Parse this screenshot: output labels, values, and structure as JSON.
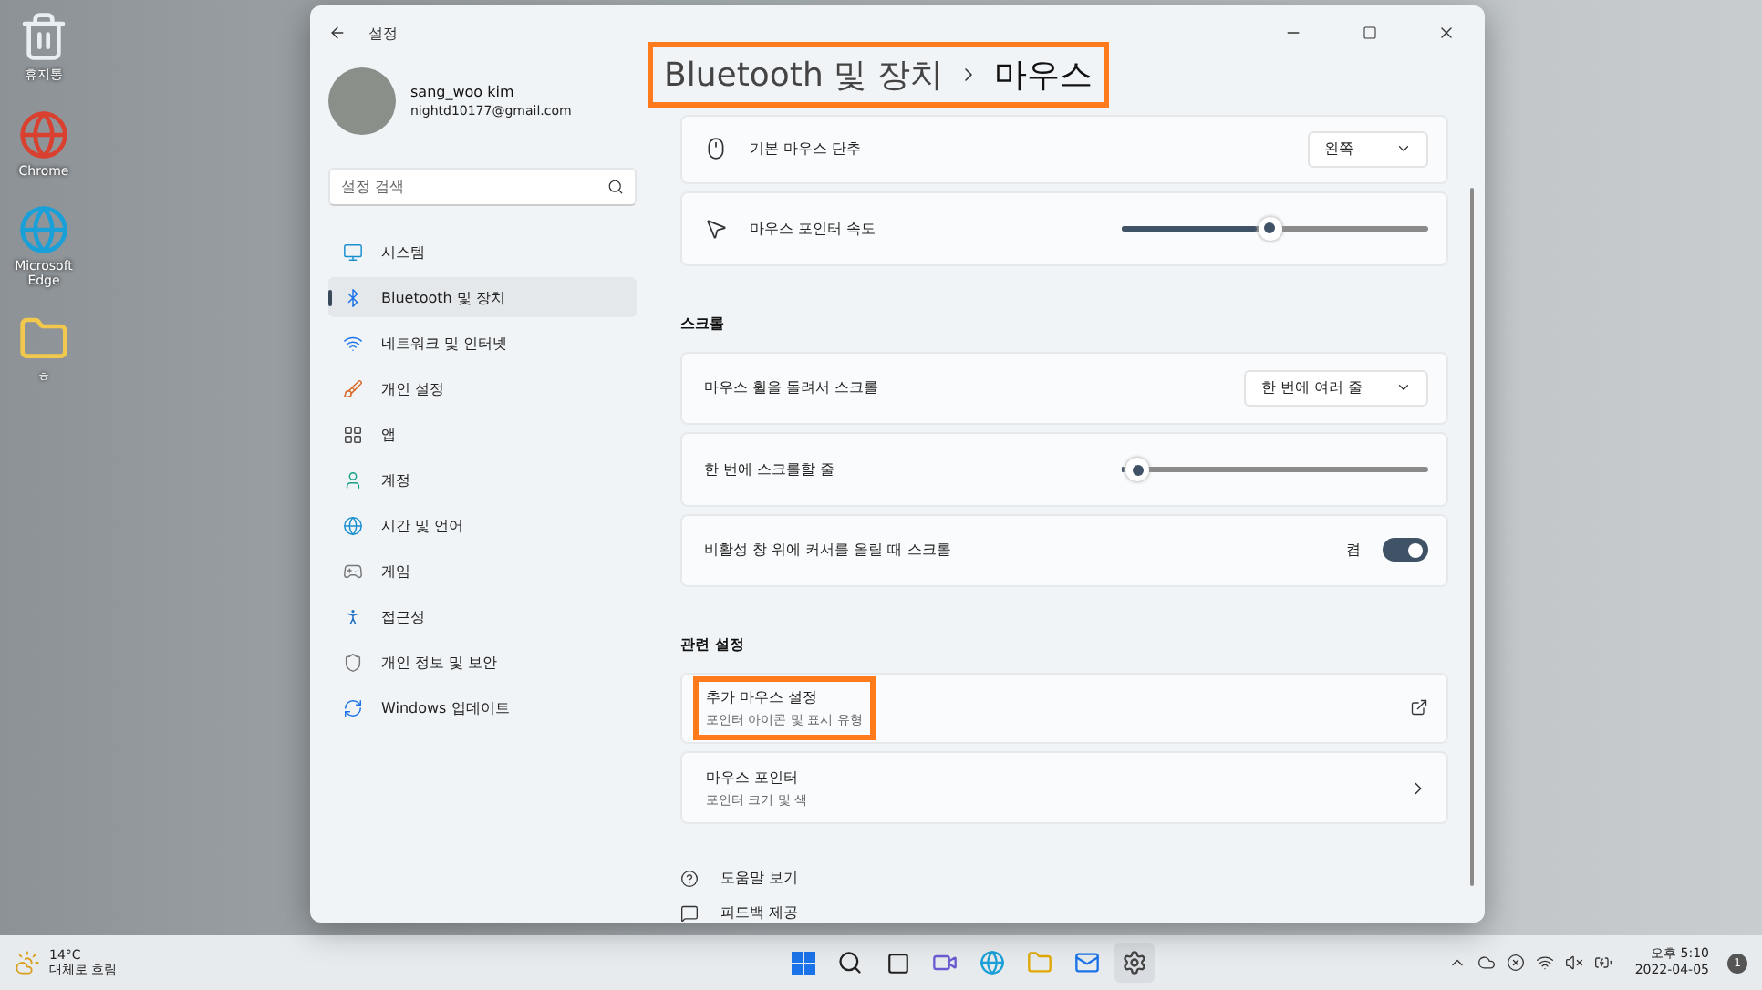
{
  "desktop_icons": [
    {
      "label": "휴지통"
    },
    {
      "label": "Chrome"
    },
    {
      "label": "Microsoft Edge"
    },
    {
      "label": "ㅎ"
    }
  ],
  "window": {
    "title": "설정"
  },
  "profile": {
    "name": "sang_woo kim",
    "email": "nightd10177@gmail.com"
  },
  "search": {
    "placeholder": "설정 검색"
  },
  "nav_items": [
    {
      "label": "시스템",
      "selected": false
    },
    {
      "label": "Bluetooth 및 장치",
      "selected": true
    },
    {
      "label": "네트워크 및 인터넷",
      "selected": false
    },
    {
      "label": "개인 설정",
      "selected": false
    },
    {
      "label": "앱",
      "selected": false
    },
    {
      "label": "계정",
      "selected": false
    },
    {
      "label": "시간 및 언어",
      "selected": false
    },
    {
      "label": "게임",
      "selected": false
    },
    {
      "label": "접근성",
      "selected": false
    },
    {
      "label": "개인 정보 및 보안",
      "selected": false
    },
    {
      "label": "Windows 업데이트",
      "selected": false
    }
  ],
  "breadcrumb": {
    "parent": "Bluetooth 및 장치",
    "current": "마우스",
    "highlighted": true
  },
  "sections": [
    {
      "cards": [
        {
          "kind": "dropdown",
          "label": "기본 마우스 단추",
          "value": "왼쪽"
        },
        {
          "kind": "slider",
          "label": "마우스 포인터 속도",
          "level": 0.48
        }
      ]
    },
    {
      "title": "스크롤",
      "cards": [
        {
          "kind": "dropdown",
          "label": "마우스 휠을 돌려서 스크롤",
          "value": "한 번에 여러 줄"
        },
        {
          "kind": "slider",
          "label": "한 번에 스크롤할 줄",
          "level": 0.05
        },
        {
          "kind": "toggle",
          "label": "비활성 창 위에 커서를 올릴 때 스크롤",
          "state_text": "켬",
          "on": true
        }
      ]
    },
    {
      "title": "관련 설정",
      "cards": [
        {
          "kind": "external",
          "label": "추가 마우스 설정",
          "subtitle": "포인터 아이콘 및 표시 유형",
          "highlighted": true
        },
        {
          "kind": "nav",
          "label": "마우스 포인터",
          "subtitle": "포인터 크기 및 색",
          "highlighted": false
        }
      ]
    }
  ],
  "help_links": [
    {
      "label": "도움말 보기"
    },
    {
      "label": "피드백 제공"
    }
  ],
  "taskbar": {
    "weather": {
      "temperature": "14°C",
      "condition": "대체로 흐림"
    },
    "clock": {
      "time": "오후 5:10",
      "date": "2022-04-05"
    },
    "notifications": "1"
  }
}
